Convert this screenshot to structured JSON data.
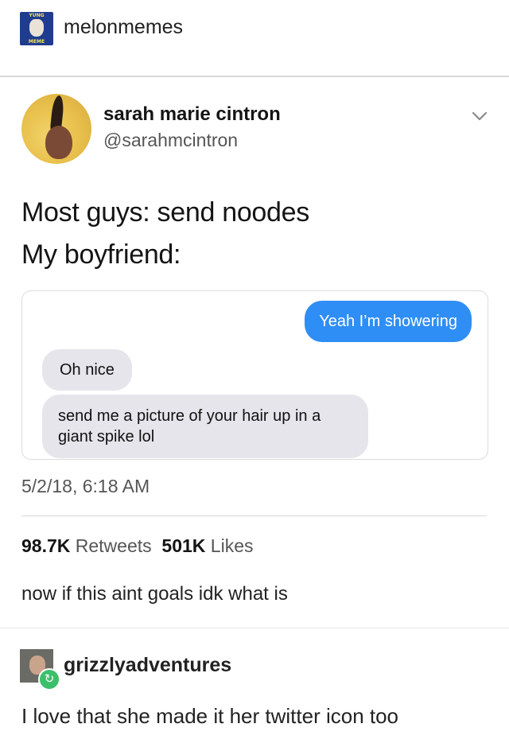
{
  "header": {
    "blog_name": "melonmemes",
    "avatar_text_top": "YUNG",
    "avatar_text_bottom": "MEME"
  },
  "tweet": {
    "display_name": "sarah marie cintron",
    "handle": "@sarahmcintron",
    "menu_icon": "chevron-down-icon",
    "text_line1": "Most guys: send noodes",
    "text_line2": "My boyfriend:",
    "messages": {
      "outgoing": "Yeah I’m showering",
      "incoming1": "Oh nice",
      "incoming2": "send me a picture of your hair up in a giant spike lol"
    },
    "timestamp": "5/2/18, 6:18 AM",
    "retweets_count": "98.7K",
    "retweets_label": "Retweets",
    "likes_count": "501K",
    "likes_label": "Likes"
  },
  "caption": "now if this aint goals idk what is",
  "reblog": {
    "blog_name": "grizzlyadventures",
    "badge_icon": "reblog-icon",
    "comment": "I love that she made it her twitter icon too"
  },
  "colors": {
    "imessage_blue": "#2f8ef5",
    "incoming_gray": "#e6e5eb",
    "reblog_green": "#3cbf6a"
  }
}
